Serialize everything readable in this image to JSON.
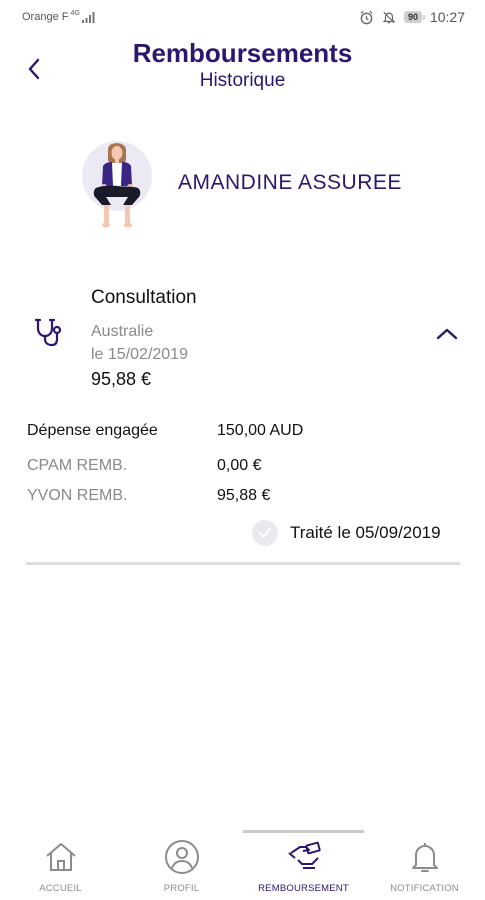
{
  "status_bar": {
    "carrier": "Orange F",
    "network": "4G",
    "battery": "90",
    "time": "10:27",
    "icons": [
      "alarm-icon",
      "bell-off-icon",
      "battery-icon"
    ]
  },
  "header": {
    "title": "Remboursements",
    "subtitle": "Historique",
    "back_icon": "chevron-left-icon"
  },
  "profile": {
    "name": "AMANDINE ASSUREE",
    "avatar": "person-avatar-illustration"
  },
  "claim": {
    "icon": "stethoscope-icon",
    "type": "Consultation",
    "country": "Australie",
    "date": "le 15/02/2019",
    "amount": "95,88 €",
    "toggle_icon": "chevron-up-icon",
    "details": [
      {
        "label": "Dépense engagée",
        "value": "150,00 AUD"
      },
      {
        "label": "CPAM REMB.",
        "value": "0,00 €"
      },
      {
        "label": "YVON REMB.",
        "value": "95,88 €"
      }
    ],
    "status": "Traité le 05/09/2019",
    "status_icon": "check-icon"
  },
  "nav": {
    "items": [
      {
        "label": "ACCUEIL",
        "icon": "home-icon"
      },
      {
        "label": "PROFIL",
        "icon": "profile-icon"
      },
      {
        "label": "REMBOURSEMENT",
        "icon": "reimbursement-icon",
        "active": true
      },
      {
        "label": "NOTIFICATION",
        "icon": "bell-icon"
      }
    ]
  },
  "colors": {
    "brand": "#2d1670",
    "muted_text": "#8a8a8a",
    "divider": "#dddddd"
  }
}
